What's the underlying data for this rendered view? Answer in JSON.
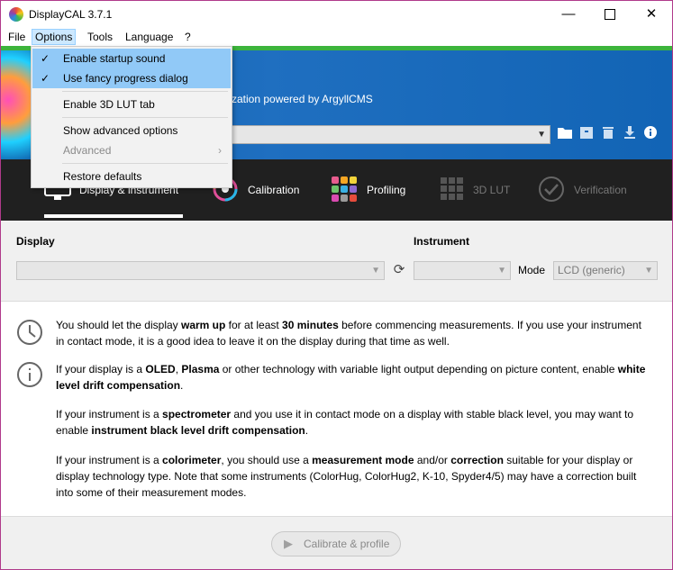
{
  "window": {
    "title": "DisplayCAL 3.7.1",
    "min_icon": "minimize-icon",
    "max_icon": "maximize-icon",
    "close_icon": "close-icon"
  },
  "menubar": {
    "items": [
      "File",
      "Options",
      "Tools",
      "Language",
      "?"
    ],
    "active": "Options"
  },
  "options_menu": {
    "items": [
      {
        "label": "Enable startup sound",
        "checked": true
      },
      {
        "label": "Use fancy progress dialog",
        "checked": true
      },
      {
        "label": "Enable 3D LUT tab",
        "checked": false
      },
      {
        "label": "Show advanced options",
        "checked": false
      },
      {
        "label": "Advanced",
        "disabled": true,
        "submenu": true
      },
      {
        "label": "Restore defaults",
        "checked": false
      }
    ]
  },
  "banner": {
    "text": "zation powered by ArgyllCMS",
    "profile_value": "",
    "icons": [
      "folder-icon",
      "archive-icon",
      "trash-icon",
      "download-icon",
      "info-icon"
    ]
  },
  "tabs": [
    {
      "label": "Display & instrument",
      "icon": "monitor-icon",
      "active": true
    },
    {
      "label": "Calibration",
      "icon": "calibration-icon"
    },
    {
      "label": "Profiling",
      "icon": "profiling-icon"
    },
    {
      "label": "3D LUT",
      "icon": "3dlut-icon",
      "disabled": true
    },
    {
      "label": "Verification",
      "icon": "verification-icon",
      "disabled": true
    }
  ],
  "settings": {
    "display_label": "Display",
    "display_value": "",
    "instrument_label": "Instrument",
    "instrument_value": "",
    "mode_label": "Mode",
    "mode_value": "LCD (generic)"
  },
  "info": {
    "p1": [
      {
        "t": "You should let the display "
      },
      {
        "t": "warm up",
        "b": true
      },
      {
        "t": " for at least "
      },
      {
        "t": "30 minutes",
        "b": true
      },
      {
        "t": " before commencing measurements. If you use your instrument in contact mode, it is a good idea to leave it on the display during that time as well."
      }
    ],
    "p2": [
      {
        "t": "If your display is a "
      },
      {
        "t": "OLED",
        "b": true
      },
      {
        "t": ", "
      },
      {
        "t": "Plasma",
        "b": true
      },
      {
        "t": " or other technology with variable light output depending on picture content, enable "
      },
      {
        "t": "white level drift compensation",
        "b": true
      },
      {
        "t": "."
      }
    ],
    "p3": [
      {
        "t": "If your instrument is a "
      },
      {
        "t": "spectrometer",
        "b": true
      },
      {
        "t": " and you use it in contact mode on a display with stable black level, you may want to enable "
      },
      {
        "t": "instrument black level drift compensation",
        "b": true
      },
      {
        "t": "."
      }
    ],
    "p4": [
      {
        "t": "If your instrument is a "
      },
      {
        "t": "colorimeter",
        "b": true
      },
      {
        "t": ", you should use a "
      },
      {
        "t": "measurement mode",
        "b": true
      },
      {
        "t": " and/or "
      },
      {
        "t": "correction",
        "b": true
      },
      {
        "t": " suitable for your display or display technology type. Note that some instruments (ColorHug, ColorHug2, K-10, Spyder4/5) may have a correction built into some of their measurement modes."
      }
    ]
  },
  "bottom": {
    "button_label": "Calibrate & profile"
  },
  "colors": {
    "accent_green": "#3cb43c",
    "banner_blue": "#1264b5",
    "tabs_bg": "#202020",
    "menu_check_bg": "#91c9f7"
  }
}
